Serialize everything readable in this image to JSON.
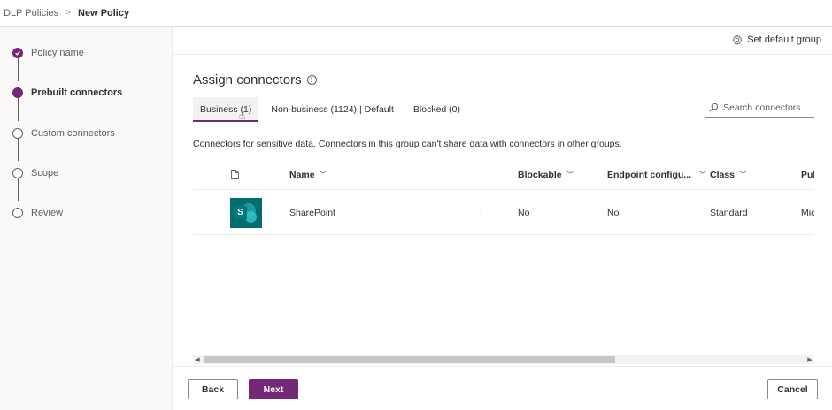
{
  "breadcrumb": {
    "parent": "DLP Policies",
    "separator": ">",
    "current": "New Policy"
  },
  "steps": [
    {
      "label": "Policy name",
      "state": "done"
    },
    {
      "label": "Prebuilt connectors",
      "state": "current"
    },
    {
      "label": "Custom connectors",
      "state": "pending"
    },
    {
      "label": "Scope",
      "state": "pending"
    },
    {
      "label": "Review",
      "state": "pending"
    }
  ],
  "command_bar": {
    "set_default_group": "Set default group"
  },
  "main": {
    "title": "Assign connectors",
    "tabs": [
      {
        "label": "Business (1)",
        "selected": true
      },
      {
        "label": "Non-business (1124) | Default",
        "selected": false
      },
      {
        "label": "Blocked (0)",
        "selected": false
      }
    ],
    "search": {
      "placeholder": "Search connectors",
      "value": ""
    },
    "description": "Connectors for sensitive data. Connectors in this group can't share data with connectors in other groups."
  },
  "table": {
    "columns": [
      "Name",
      "Blockable",
      "Endpoint configu...",
      "Class",
      "Pub"
    ],
    "rows": [
      {
        "logo_letter": "S",
        "name": "SharePoint",
        "blockable": "No",
        "endpoint": "No",
        "class": "Standard",
        "publisher": "Mic"
      }
    ]
  },
  "footer": {
    "back": "Back",
    "next": "Next",
    "cancel": "Cancel"
  },
  "colors": {
    "accent": "#742774",
    "sharepoint": "#036c70"
  }
}
